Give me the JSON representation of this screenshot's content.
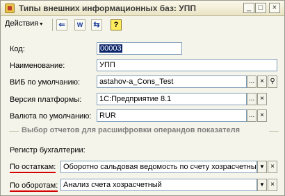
{
  "window": {
    "title": "Типы внешних информационных баз: УПП",
    "buttons": {
      "minimize": "_",
      "maximize": "□",
      "close": "×"
    }
  },
  "toolbar": {
    "actions_label": "Действия",
    "actions_arrow": "▾",
    "icons": [
      "back-arrow-icon",
      "document-icon",
      "convert-icon",
      "help-icon"
    ],
    "help_glyph": "?",
    "back_glyph": "⇐",
    "doc_glyph": "W",
    "conv_glyph": "⇆"
  },
  "form": {
    "code": {
      "label": "Код:",
      "value": "00003"
    },
    "name": {
      "label": "Наименование:",
      "value": "УПП"
    },
    "vib": {
      "label": "ВИБ по умолчанию:",
      "value": "astahov-a_Cons_Test"
    },
    "platform": {
      "label": "Версия платформы:",
      "value": "1С:Предприятие 8.1"
    },
    "currency": {
      "label": "Валюта по умолчанию:",
      "value": "RUR"
    }
  },
  "section": {
    "title": "Выбор отчетов для расшифровки операндов показателя",
    "register_label": "Регистр бухгалтерии:",
    "balances": {
      "label": "По остаткам:",
      "value": "Оборотно сальдовая ведомость по счету хозрасчетный"
    },
    "turnovers": {
      "label": "По оборотам:",
      "value": "Анализ счета хозрасчетный"
    }
  },
  "glyphs": {
    "ellipsis": "...",
    "clear": "×",
    "search": "⚲",
    "dropdown": "▼"
  },
  "colors": {
    "selection": "#0a246a",
    "underline": "#d40000",
    "section_title": "#808080"
  }
}
